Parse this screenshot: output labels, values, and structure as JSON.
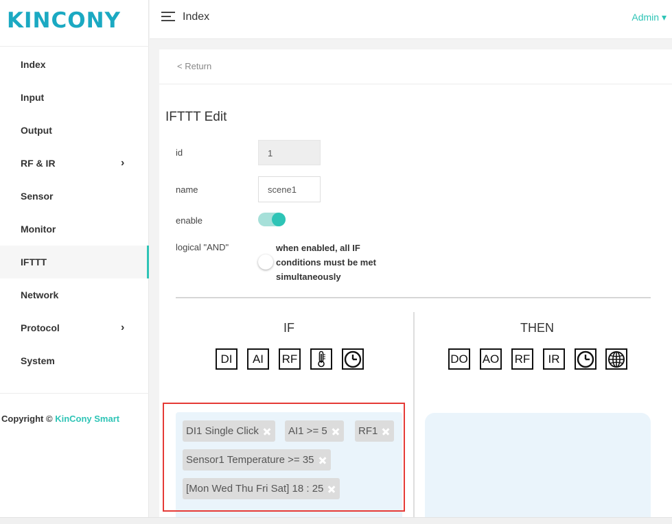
{
  "brand": {
    "logo_text": "KINCONY",
    "color": "#1ba9c2"
  },
  "sidebar": {
    "items": [
      {
        "label": "Index"
      },
      {
        "label": "Input"
      },
      {
        "label": "Output"
      },
      {
        "label": "RF & IR",
        "chevron": "›"
      },
      {
        "label": "Sensor"
      },
      {
        "label": "Monitor"
      },
      {
        "label": "IFTTT",
        "active": true
      },
      {
        "label": "Network"
      },
      {
        "label": "Protocol",
        "chevron": "›"
      },
      {
        "label": "System"
      }
    ],
    "copyright_prefix": "Copyright ©",
    "copyright_link": "KinCony Smart"
  },
  "topbar": {
    "title": "Index",
    "user": "Admin ▾"
  },
  "card": {
    "return_label": "< Return",
    "title": "IFTTT Edit",
    "fields": {
      "id_label": "id",
      "id_value": "1",
      "name_label": "name",
      "name_value": "scene1",
      "enable_label": "enable",
      "enable_on": true,
      "and_label": "logical \"AND\"",
      "and_on": false,
      "and_hint": "when enabled, all IF conditions must be met simultaneously"
    },
    "if_col": {
      "title": "IF",
      "buttons": [
        "DI",
        "AI",
        "RF",
        "thermometer-icon",
        "clock-icon"
      ],
      "conditions": [
        "DI1 Single Click",
        "AI1 >= 5",
        "RF1",
        "Sensor1 Temperature >= 35",
        "[Mon Wed Thu Fri Sat] 18 : 25"
      ]
    },
    "then_col": {
      "title": "THEN",
      "buttons": [
        "DO",
        "AO",
        "RF",
        "IR",
        "clock-icon",
        "globe-icon"
      ]
    }
  },
  "colors": {
    "accent": "#2ec4b6",
    "highlight_border": "#e53935",
    "drop_zone": "#eaf4fb"
  }
}
